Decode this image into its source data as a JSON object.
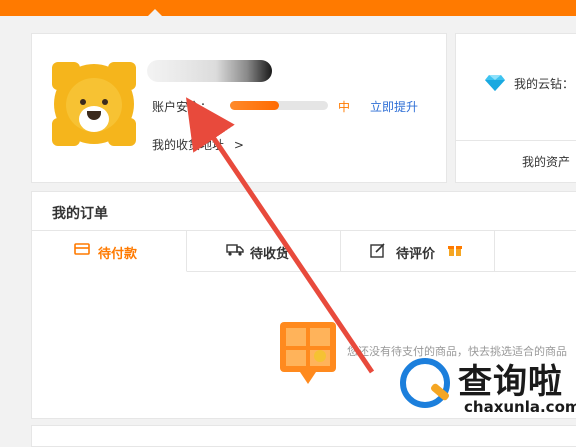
{
  "profile": {
    "security_label": "账户安全：",
    "security_level": "中",
    "security_progress": 0.5,
    "upgrade_link": "立即提升",
    "address_link": "我的收货地址",
    "address_chevron": ">"
  },
  "wallet": {
    "cloud_diamond_label": "我的云钻：",
    "assets_label": "我的资产"
  },
  "orders": {
    "title": "我的订单",
    "tabs": [
      {
        "label": "待付款",
        "icon": "wallet-icon",
        "active": true
      },
      {
        "label": "待收货",
        "icon": "truck-icon",
        "active": false
      },
      {
        "label": "待评价",
        "icon": "edit-icon",
        "badge_icon": "gift-icon",
        "active": false
      }
    ],
    "empty_text": "您还没有待支付的商品，快去挑选适合的商品"
  },
  "watermark": {
    "title": "查询啦",
    "domain": "chaxunla.com"
  },
  "colors": {
    "accent": "#ff7a00",
    "link": "#2f6fd6",
    "annotation_arrow": "#e84a3c"
  }
}
